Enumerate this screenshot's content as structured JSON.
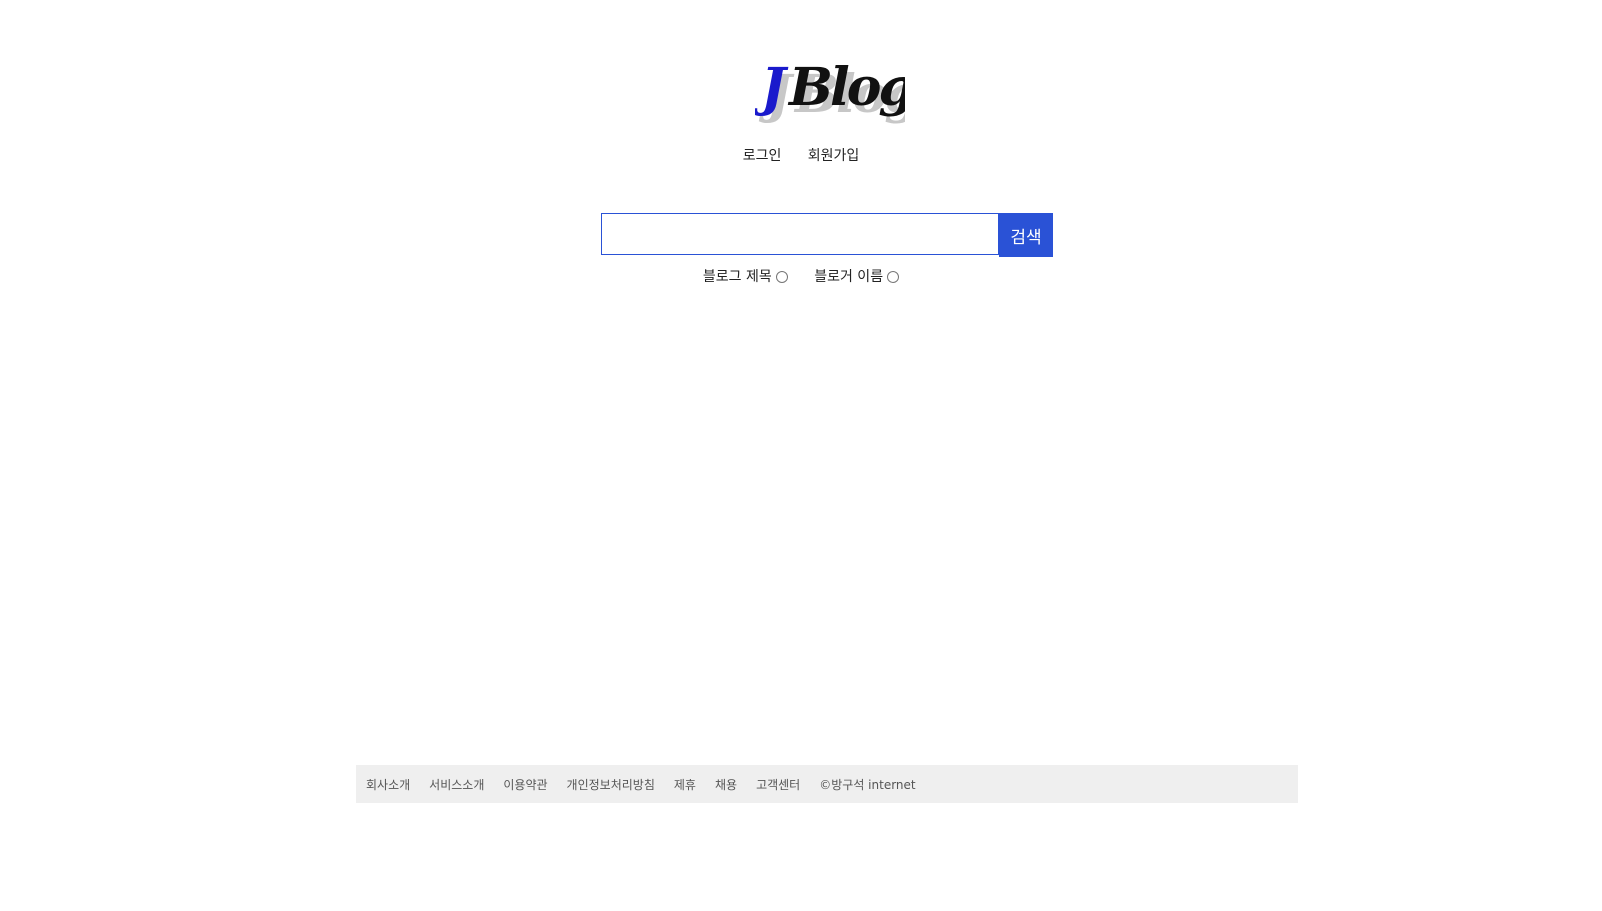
{
  "logo": {
    "text_j": "J",
    "text_rest": "Blog",
    "accent_color": "#1a1acc"
  },
  "auth_menu": {
    "login_label": "로그인",
    "join_label": "회원가입"
  },
  "search": {
    "input_value": "",
    "button_label": "검색",
    "accent_color": "#2a52d6",
    "options": [
      {
        "label": "블로그 제목",
        "checked": false
      },
      {
        "label": "블로거 이름",
        "checked": false
      }
    ]
  },
  "footer": {
    "links": [
      "회사소개",
      "서비스소개",
      "이용약관",
      "개인정보처리방침",
      "제휴",
      "채용",
      "고객센터"
    ],
    "copyright": "©방구석 internet"
  }
}
